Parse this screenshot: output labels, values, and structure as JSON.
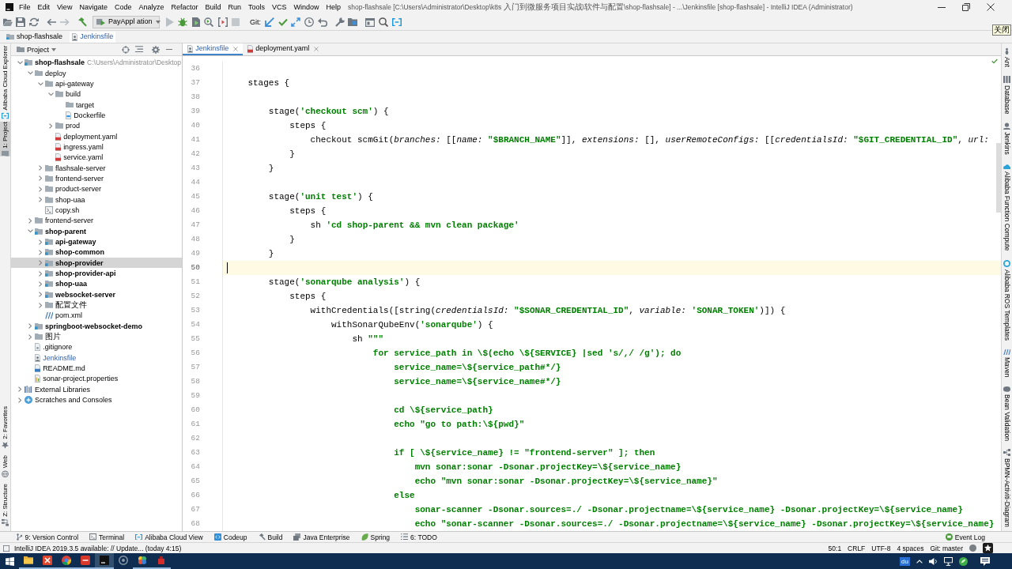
{
  "window": {
    "title": "shop-flashsale [C:\\Users\\Administrator\\Desktop\\k8s 入门到微服务项目实战\\软件与配置\\shop-flashsale] - ...\\Jenkinsfile [shop-flashsale] - IntelliJ IDEA (Administrator)"
  },
  "menu": [
    "File",
    "Edit",
    "View",
    "Navigate",
    "Code",
    "Analyze",
    "Refactor",
    "Build",
    "Run",
    "Tools",
    "VCS",
    "Window",
    "Help"
  ],
  "toolbar": {
    "run_config": "PayAppl ation",
    "vcs_label": "Git:"
  },
  "tooltip": "关闭",
  "breadcrumbs": [
    {
      "label": "shop-flashsale",
      "kind": "module",
      "selected": false,
      "modified": false
    },
    {
      "label": "Jenkinsfile",
      "kind": "jenkins",
      "selected": true,
      "modified": true
    }
  ],
  "left_stripe": {
    "top": [
      {
        "label": "Alibaba Cloud Explorer",
        "kind": "cloud",
        "selected": false
      },
      {
        "label": "1: Project",
        "kind": "project",
        "selected": true
      }
    ],
    "bottom": [
      {
        "label": "2: Favorites",
        "kind": "favorites",
        "selected": false
      },
      {
        "label": "Web",
        "kind": "web",
        "selected": false
      },
      {
        "label": "Z: Structure",
        "kind": "structure",
        "selected": false
      }
    ]
  },
  "project_panel": {
    "title": "Project",
    "tree": [
      {
        "label": "shop-flashsale",
        "kind": "module",
        "path": "C:\\Users\\Administrator\\Desktop",
        "expanded": true,
        "selected": false,
        "modified": false,
        "children": [
          {
            "label": "deploy",
            "kind": "folder",
            "expanded": true,
            "selected": false,
            "modified": false,
            "children": [
              {
                "label": "api-gateway",
                "kind": "folder",
                "expanded": true,
                "selected": false,
                "modified": false,
                "children": [
                  {
                    "label": "build",
                    "kind": "folder",
                    "expanded": true,
                    "selected": false,
                    "modified": false,
                    "children": [
                      {
                        "label": "target",
                        "kind": "folder",
                        "selected": false,
                        "modified": false
                      },
                      {
                        "label": "Dockerfile",
                        "kind": "docker",
                        "selected": false,
                        "modified": false
                      }
                    ]
                  },
                  {
                    "label": "prod",
                    "kind": "folder",
                    "expanded": false,
                    "selected": false,
                    "modified": false
                  },
                  {
                    "label": "deployment.yaml",
                    "kind": "yaml",
                    "selected": false,
                    "modified": false
                  },
                  {
                    "label": "ingress.yaml",
                    "kind": "yaml",
                    "selected": false,
                    "modified": false
                  },
                  {
                    "label": "service.yaml",
                    "kind": "yaml",
                    "selected": false,
                    "modified": false
                  }
                ]
              },
              {
                "label": "flashsale-server",
                "kind": "folder",
                "expanded": false,
                "selected": false,
                "modified": false
              },
              {
                "label": "frontend-server",
                "kind": "folder",
                "expanded": false,
                "selected": false,
                "modified": false
              },
              {
                "label": "product-server",
                "kind": "folder",
                "expanded": false,
                "selected": false,
                "modified": false
              },
              {
                "label": "shop-uaa",
                "kind": "folder",
                "expanded": false,
                "selected": false,
                "modified": false
              },
              {
                "label": "copy.sh",
                "kind": "shell",
                "selected": false,
                "modified": false
              }
            ]
          },
          {
            "label": "frontend-server",
            "kind": "folder",
            "expanded": false,
            "selected": false,
            "modified": false
          },
          {
            "label": "shop-parent",
            "kind": "module",
            "expanded": true,
            "selected": false,
            "modified": false,
            "children": [
              {
                "label": "api-gateway",
                "kind": "module",
                "expanded": false,
                "selected": false,
                "modified": false
              },
              {
                "label": "shop-common",
                "kind": "module",
                "expanded": false,
                "selected": false,
                "modified": false
              },
              {
                "label": "shop-provider",
                "kind": "module",
                "expanded": false,
                "selected": true,
                "modified": false
              },
              {
                "label": "shop-provider-api",
                "kind": "module",
                "expanded": false,
                "selected": false,
                "modified": false
              },
              {
                "label": "shop-uaa",
                "kind": "module",
                "expanded": false,
                "selected": false,
                "modified": false
              },
              {
                "label": "websocket-server",
                "kind": "module",
                "expanded": false,
                "selected": false,
                "modified": false
              },
              {
                "label": "配置文件",
                "kind": "folder",
                "expanded": false,
                "selected": false,
                "modified": false
              },
              {
                "label": "pom.xml",
                "kind": "maven",
                "selected": false,
                "modified": false
              }
            ]
          },
          {
            "label": "springboot-websocket-demo",
            "kind": "module",
            "expanded": false,
            "selected": false,
            "modified": false
          },
          {
            "label": "图片",
            "kind": "folder",
            "expanded": false,
            "selected": false,
            "modified": false
          },
          {
            "label": ".gitignore",
            "kind": "ignore",
            "selected": false,
            "modified": false
          },
          {
            "label": "Jenkinsfile",
            "kind": "jenkins",
            "selected": false,
            "modified": true
          },
          {
            "label": "README.md",
            "kind": "markdown",
            "selected": false,
            "modified": false
          },
          {
            "label": "sonar-project.properties",
            "kind": "properties",
            "selected": false,
            "modified": false
          }
        ]
      },
      {
        "label": "External Libraries",
        "kind": "libraries",
        "expanded": false,
        "selected": false,
        "modified": false
      },
      {
        "label": "Scratches and Consoles",
        "kind": "scratches",
        "expanded": false,
        "selected": false,
        "modified": false
      }
    ]
  },
  "editor": {
    "tabs": [
      {
        "label": "Jenkinsfile",
        "kind": "jenkins",
        "selected": true,
        "modified": true
      },
      {
        "label": "deployment.yaml",
        "kind": "yaml",
        "selected": false,
        "modified": false
      }
    ],
    "lines": [
      {
        "number": "36",
        "current": false
      },
      {
        "number": "37",
        "current": false,
        "code": [
          {
            "kind": "plain",
            "text": "    stages {"
          }
        ]
      },
      {
        "number": "38",
        "current": false
      },
      {
        "number": "39",
        "current": false,
        "code": [
          {
            "kind": "plain",
            "text": "        stage("
          },
          {
            "kind": "string",
            "text": "'checkout scm'"
          },
          {
            "kind": "plain",
            "text": ") {"
          }
        ]
      },
      {
        "number": "40",
        "current": false,
        "code": [
          {
            "kind": "plain",
            "text": "            steps {"
          }
        ]
      },
      {
        "number": "41",
        "current": false,
        "code": [
          {
            "kind": "plain",
            "text": "                checkout scmGit("
          },
          {
            "kind": "named",
            "text": "branches:"
          },
          {
            "kind": "plain",
            "text": " [["
          },
          {
            "kind": "named",
            "text": "name: "
          },
          {
            "kind": "string",
            "text": "\"$BRANCH_NAME\""
          },
          {
            "kind": "plain",
            "text": "]], "
          },
          {
            "kind": "named",
            "text": "extensions:"
          },
          {
            "kind": "plain",
            "text": " [], "
          },
          {
            "kind": "named",
            "text": "userRemoteConfigs:"
          },
          {
            "kind": "plain",
            "text": " [["
          },
          {
            "kind": "named",
            "text": "credentialsId: "
          },
          {
            "kind": "string",
            "text": "\"$GIT_CREDENTIAL_ID\""
          },
          {
            "kind": "plain",
            "text": ", "
          },
          {
            "kind": "named",
            "text": "url:"
          }
        ]
      },
      {
        "number": "42",
        "current": false,
        "code": [
          {
            "kind": "plain",
            "text": "            }"
          }
        ]
      },
      {
        "number": "43",
        "current": false,
        "code": [
          {
            "kind": "plain",
            "text": "        }"
          }
        ]
      },
      {
        "number": "44",
        "current": false
      },
      {
        "number": "45",
        "current": false,
        "code": [
          {
            "kind": "plain",
            "text": "        stage("
          },
          {
            "kind": "string",
            "text": "'unit test'"
          },
          {
            "kind": "plain",
            "text": ") {"
          }
        ]
      },
      {
        "number": "46",
        "current": false,
        "code": [
          {
            "kind": "plain",
            "text": "            steps {"
          }
        ]
      },
      {
        "number": "47",
        "current": false,
        "code": [
          {
            "kind": "plain",
            "text": "                sh "
          },
          {
            "kind": "string",
            "text": "'cd shop-parent && mvn clean package'"
          }
        ]
      },
      {
        "number": "48",
        "current": false,
        "code": [
          {
            "kind": "plain",
            "text": "            }"
          }
        ]
      },
      {
        "number": "49",
        "current": false,
        "code": [
          {
            "kind": "plain",
            "text": "        }"
          }
        ]
      },
      {
        "number": "50",
        "current": true
      },
      {
        "number": "51",
        "current": false,
        "code": [
          {
            "kind": "plain",
            "text": "        stage("
          },
          {
            "kind": "string",
            "text": "'sonarqube analysis'"
          },
          {
            "kind": "plain",
            "text": ") {"
          }
        ]
      },
      {
        "number": "52",
        "current": false,
        "code": [
          {
            "kind": "plain",
            "text": "            steps {"
          }
        ]
      },
      {
        "number": "53",
        "current": false,
        "code": [
          {
            "kind": "plain",
            "text": "                withCredentials([string("
          },
          {
            "kind": "named",
            "text": "credentialsId: "
          },
          {
            "kind": "string",
            "text": "\"$SONAR_CREDENTIAL_ID\""
          },
          {
            "kind": "plain",
            "text": ", "
          },
          {
            "kind": "named",
            "text": "variable: "
          },
          {
            "kind": "string",
            "text": "'SONAR_TOKEN'"
          },
          {
            "kind": "plain",
            "text": ")]) {"
          }
        ]
      },
      {
        "number": "54",
        "current": false,
        "code": [
          {
            "kind": "plain",
            "text": "                    withSonarQubeEnv("
          },
          {
            "kind": "string",
            "text": "'sonarqube'"
          },
          {
            "kind": "plain",
            "text": ") {"
          }
        ]
      },
      {
        "number": "55",
        "current": false,
        "code": [
          {
            "kind": "plain",
            "text": "                        sh "
          },
          {
            "kind": "string",
            "text": "\"\"\""
          }
        ]
      },
      {
        "number": "56",
        "current": false,
        "code": [
          {
            "kind": "string",
            "text": "                            for service_path in \\$(echo \\${SERVICE} |sed 's/,/ /g'); do"
          }
        ]
      },
      {
        "number": "57",
        "current": false,
        "code": [
          {
            "kind": "string",
            "text": "                                service_name=\\${service_path#*/}"
          }
        ]
      },
      {
        "number": "58",
        "current": false,
        "code": [
          {
            "kind": "string",
            "text": "                                service_name=\\${service_name#*/}"
          }
        ]
      },
      {
        "number": "59",
        "current": false
      },
      {
        "number": "60",
        "current": false,
        "code": [
          {
            "kind": "string",
            "text": "                                cd \\${service_path}"
          }
        ]
      },
      {
        "number": "61",
        "current": false,
        "code": [
          {
            "kind": "string",
            "text": "                                echo \"go to path:\\${pwd}\""
          }
        ]
      },
      {
        "number": "62",
        "current": false
      },
      {
        "number": "63",
        "current": false,
        "code": [
          {
            "kind": "string",
            "text": "                                if [ \\${service_name} != \"frontend-server\" ]; then"
          }
        ]
      },
      {
        "number": "64",
        "current": false,
        "code": [
          {
            "kind": "string",
            "text": "                                    mvn sonar:sonar -Dsonar.projectKey=\\${service_name}"
          }
        ]
      },
      {
        "number": "65",
        "current": false,
        "code": [
          {
            "kind": "string",
            "text": "                                    echo \"mvn sonar:sonar -Dsonar.projectKey=\\${service_name}\""
          }
        ]
      },
      {
        "number": "66",
        "current": false,
        "code": [
          {
            "kind": "string",
            "text": "                                else"
          }
        ]
      },
      {
        "number": "67",
        "current": false,
        "code": [
          {
            "kind": "string",
            "text": "                                    sonar-scanner -Dsonar.sources=./ -Dsonar.projectname=\\${service_name} -Dsonar.projectKey=\\${service_name}"
          }
        ]
      },
      {
        "number": "68",
        "current": false,
        "code": [
          {
            "kind": "string",
            "text": "                                    echo \"sonar-scanner -Dsonar.sources=./ -Dsonar.projectname=\\${service_name} -Dsonar.projectKey=\\${service_name}"
          }
        ]
      }
    ]
  },
  "right_stripe": [
    {
      "label": "Ant",
      "kind": "ant",
      "selected": false
    },
    {
      "label": "Database",
      "kind": "database",
      "selected": false
    },
    {
      "label": "Jenkins",
      "kind": "ci",
      "selected": false
    },
    {
      "label": "Alibaba Function Compute",
      "kind": "function",
      "selected": false
    },
    {
      "label": "Alibaba ROS Templates",
      "kind": "ros",
      "selected": false
    },
    {
      "label": "Maven",
      "kind": "maven",
      "selected": false
    },
    {
      "label": "Bean Validation",
      "kind": "bean",
      "selected": false
    },
    {
      "label": "BPMN-Activiti-Diagram",
      "kind": "bpmn",
      "selected": false
    }
  ],
  "tool_windows": [
    {
      "label": "9: Version Control",
      "kind": "vcs"
    },
    {
      "label": "Terminal",
      "kind": "terminal"
    },
    {
      "label": "Alibaba Cloud View",
      "kind": "cloudview"
    },
    {
      "label": "Codeup",
      "kind": "codeup"
    },
    {
      "label": "Build",
      "kind": "build"
    },
    {
      "label": "Java Enterprise",
      "kind": "javaee"
    },
    {
      "label": "Spring",
      "kind": "spring"
    },
    {
      "label": "6: TODO",
      "kind": "todo"
    }
  ],
  "event_log": "Event Log",
  "status_bar": {
    "message": "IntelliJ IDEA 2019.3.5 available: // Update... (today 4:15)",
    "items": [
      "50:1",
      "CRLF",
      "UTF-8",
      "4 spaces",
      "Git: master"
    ]
  },
  "taskbar": {
    "apps": [
      {
        "kind": "files",
        "selected": false,
        "running": true
      },
      {
        "kind": "tool",
        "selected": false,
        "running": true
      },
      {
        "kind": "browser",
        "selected": false,
        "running": true
      },
      {
        "kind": "office",
        "selected": false,
        "running": true
      },
      {
        "kind": "ide",
        "selected": true,
        "running": true
      },
      {
        "kind": "ring",
        "selected": false,
        "running": false
      },
      {
        "kind": "petal",
        "selected": false,
        "running": true
      },
      {
        "kind": "box",
        "selected": false,
        "running": true
      }
    ],
    "tray_label": "du"
  }
}
